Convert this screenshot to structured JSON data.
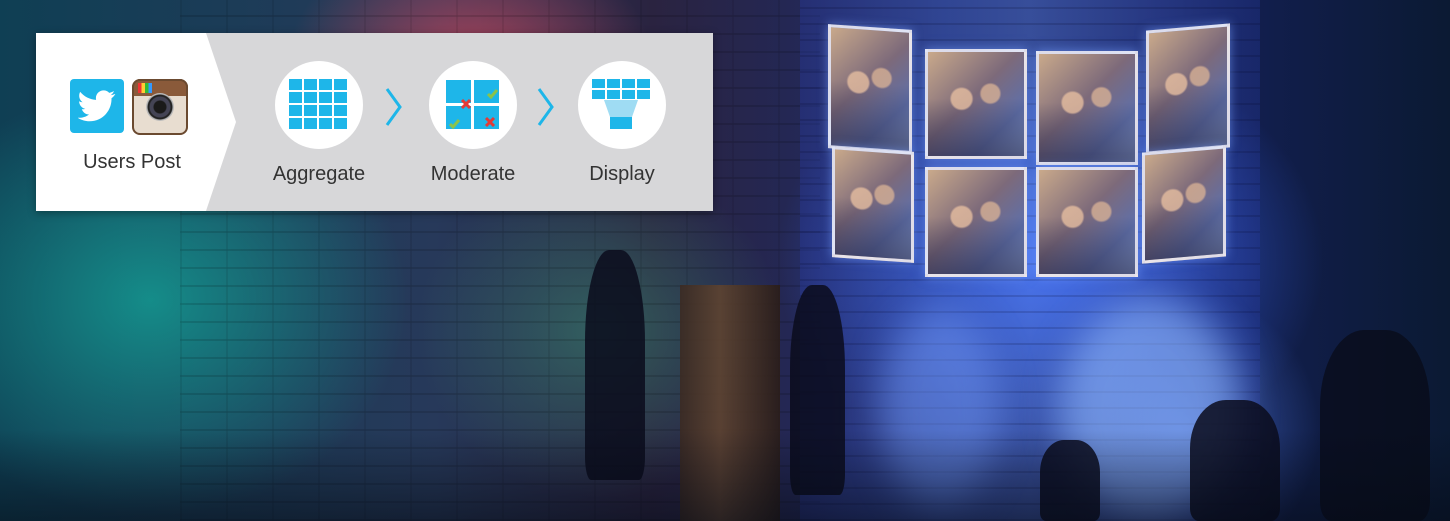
{
  "panel": {
    "source_label": "Users Post",
    "source_icons": [
      "twitter-icon",
      "instagram-icon"
    ],
    "steps": [
      {
        "label": "Aggregate",
        "icon": "grid-icon"
      },
      {
        "label": "Moderate",
        "icon": "moderation-grid-icon"
      },
      {
        "label": "Display",
        "icon": "display-wall-icon"
      }
    ],
    "accent_color": "#1eb6e9",
    "reject_color": "#e53935",
    "approve_color": "#8bc34a"
  }
}
